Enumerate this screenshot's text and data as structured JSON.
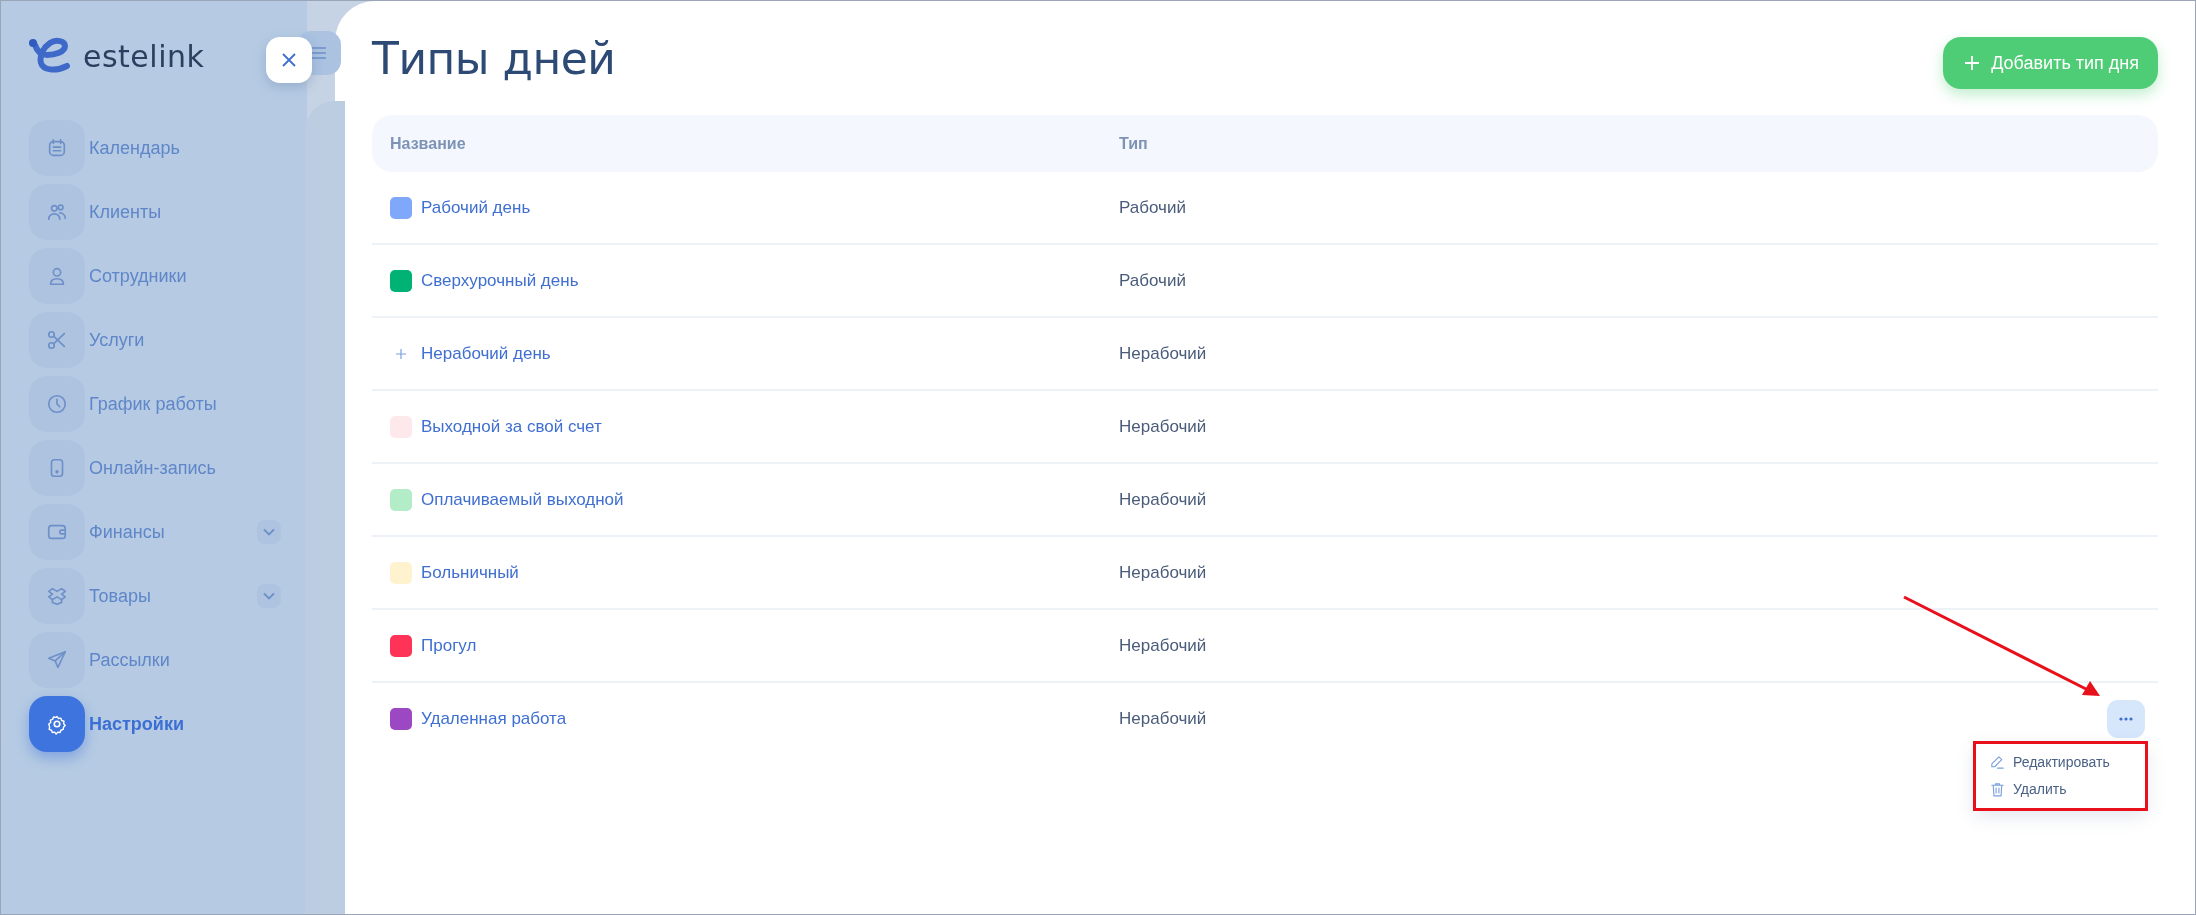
{
  "sidebar": {
    "logo": "estelink",
    "items": [
      {
        "label": "Календарь",
        "selected": false,
        "has_submenu": false
      },
      {
        "label": "Клиенты",
        "selected": false,
        "has_submenu": false
      },
      {
        "label": "Сотрудники",
        "selected": false,
        "has_submenu": false
      },
      {
        "label": "Услуги",
        "selected": false,
        "has_submenu": false
      },
      {
        "label": "График работы",
        "selected": false,
        "has_submenu": false
      },
      {
        "label": "Онлайн-запись",
        "selected": false,
        "has_submenu": false
      },
      {
        "label": "Финансы",
        "selected": false,
        "has_submenu": true
      },
      {
        "label": "Товары",
        "selected": false,
        "has_submenu": true
      },
      {
        "label": "Рассылки",
        "selected": false,
        "has_submenu": false
      },
      {
        "label": "Настройки",
        "selected": true,
        "has_submenu": false
      }
    ]
  },
  "page": {
    "title": "Типы дней",
    "add_button": "Добавить тип дня"
  },
  "table": {
    "columns": [
      "Название",
      "Тип"
    ],
    "rows": [
      {
        "name": "Рабочий день",
        "type": "Рабочий",
        "kind": "color",
        "color": "#7fa7fa",
        "menu_open": false
      },
      {
        "name": "Сверхурочный день",
        "type": "Рабочий",
        "kind": "color",
        "color": "#00b374",
        "menu_open": false
      },
      {
        "name": "Нерабочий день",
        "type": "Нерабочий",
        "kind": "plus",
        "menu_open": false
      },
      {
        "name": "Выходной за свой счет",
        "type": "Нерабочий",
        "kind": "color",
        "color": "#fde9ec",
        "menu_open": false
      },
      {
        "name": "Оплачиваемый выходной",
        "type": "Нерабочий",
        "kind": "color",
        "color": "#b2edc7",
        "menu_open": false
      },
      {
        "name": "Больничный",
        "type": "Нерабочий",
        "kind": "color",
        "color": "#fff3cf",
        "menu_open": false
      },
      {
        "name": "Прогул",
        "type": "Нерабочий",
        "kind": "color",
        "color": "#fe3357",
        "menu_open": false
      },
      {
        "name": "Удаленная работа",
        "type": "Нерабочий",
        "kind": "color",
        "color": "#9b48c2",
        "menu_open": true
      }
    ]
  },
  "row_menu": {
    "items": [
      {
        "kind": "edit",
        "label": "Редактировать"
      },
      {
        "kind": "delete",
        "label": "Удалить"
      }
    ]
  }
}
